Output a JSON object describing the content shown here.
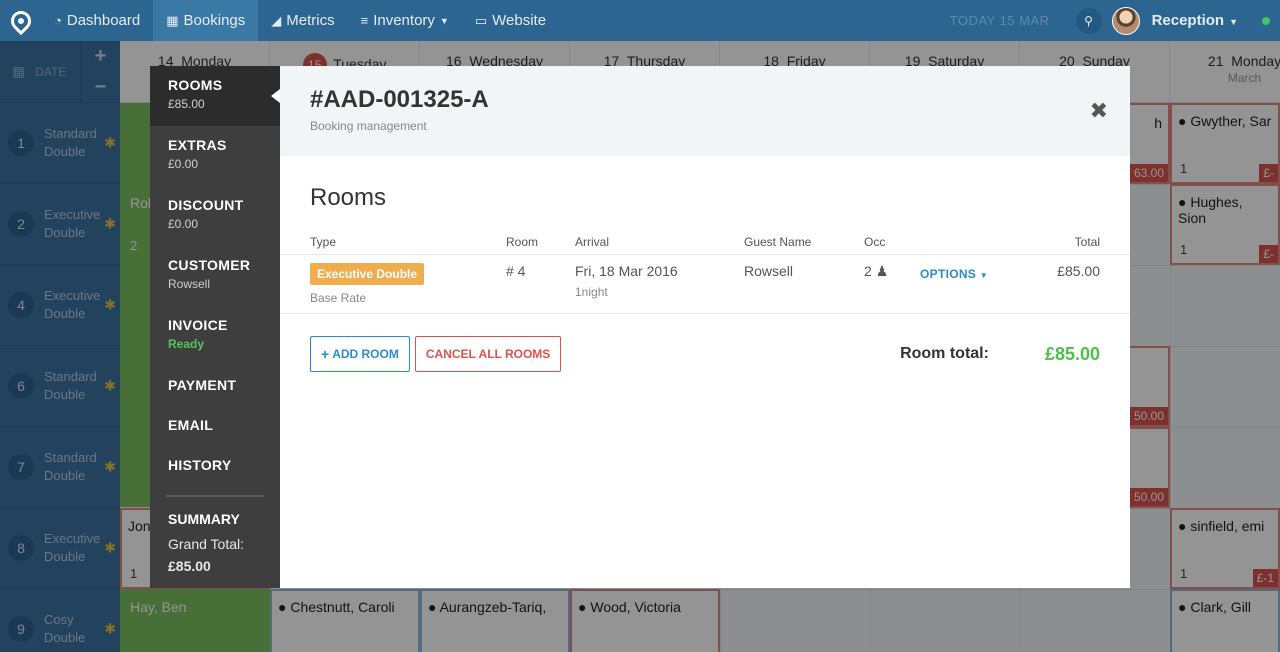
{
  "nav": {
    "items": [
      {
        "icon": "dashboard-icon",
        "glyph": "◔",
        "label": "Dashboard"
      },
      {
        "icon": "bookings-icon",
        "glyph": "▦",
        "label": "Bookings"
      },
      {
        "icon": "metrics-icon",
        "glyph": "◢",
        "label": "Metrics"
      },
      {
        "icon": "inventory-icon",
        "glyph": "≡",
        "label": "Inventory"
      },
      {
        "icon": "website-icon",
        "glyph": "▭",
        "label": "Website"
      }
    ],
    "today": "TODAY 15 MAR",
    "user": "Reception"
  },
  "calendar": {
    "date_label": "DATE",
    "days": [
      {
        "num": "14",
        "name": "Monday"
      },
      {
        "num": "15",
        "name": "Tuesday"
      },
      {
        "num": "16",
        "name": "Wednesday"
      },
      {
        "num": "17",
        "name": "Thursday"
      },
      {
        "num": "18",
        "name": "Friday"
      },
      {
        "num": "19",
        "name": "Saturday"
      },
      {
        "num": "20",
        "name": "Sunday"
      },
      {
        "num": "21",
        "name": "Monday",
        "month": "March"
      }
    ],
    "rooms": [
      {
        "num": "1",
        "line1": "Standard",
        "line2": "Double"
      },
      {
        "num": "2",
        "line1": "Executive",
        "line2": "Double"
      },
      {
        "num": "4",
        "line1": "Executive",
        "line2": "Double"
      },
      {
        "num": "6",
        "line1": "Standard",
        "line2": "Double"
      },
      {
        "num": "7",
        "line1": "Standard",
        "line2": "Double"
      },
      {
        "num": "8",
        "line1": "Executive",
        "line2": "Double"
      },
      {
        "num": "9",
        "line1": "Cosy",
        "line2": "Double"
      }
    ],
    "bookings": {
      "gwyther": "Gwyther, Sar",
      "hughes": "Hughes, Sion",
      "sinfield": "sinfield, emi",
      "clark": "Clark, Gill",
      "chestnutt": "Chestnutt, Caroli",
      "aurangzeb": "Aurangzeb-Tariq,",
      "wood": "Wood, Victoria",
      "hay": "Hay, Ben",
      "jon": "Jon",
      "rol": "Rol",
      "occ_one": "1",
      "occ_two": "2",
      "price_63": "63.00",
      "price_50a": "50.00",
      "price_50b": "50.00",
      "price_neg1": "£-",
      "price_neg2": "£-",
      "price_neg3": "£-1",
      "fragment_h": "h"
    }
  },
  "modal": {
    "sidebar": {
      "rooms_label": "ROOMS",
      "rooms_sub": "£85.00",
      "extras_label": "EXTRAS",
      "extras_sub": "£0.00",
      "discount_label": "DISCOUNT",
      "discount_sub": "£0.00",
      "customer_label": "CUSTOMER",
      "customer_sub": "Rowsell",
      "invoice_label": "INVOICE",
      "invoice_sub": "Ready",
      "payment_label": "PAYMENT",
      "email_label": "EMAIL",
      "history_label": "HISTORY",
      "summary_label": "SUMMARY",
      "grand_total_label": "Grand Total:",
      "grand_total_value": "£85.00"
    },
    "title": "#AAD-001325-A",
    "subtitle": "Booking management",
    "section_title": "Rooms",
    "columns": {
      "type": "Type",
      "room": "Room",
      "arrival": "Arrival",
      "guest": "Guest Name",
      "occ": "Occ",
      "total": "Total"
    },
    "row": {
      "type": "Executive Double",
      "rate": "Base Rate",
      "room": "# 4",
      "arrival": "Fri, 18 Mar 2016",
      "nights": "1night",
      "guest": "Rowsell",
      "occ": "2",
      "options": "OPTIONS",
      "total": "£85.00"
    },
    "add_room": "ADD ROOM",
    "cancel_all": "CANCEL ALL ROOMS",
    "room_total_label": "Room total:",
    "room_total_value": "£85.00"
  },
  "colors": {
    "accent": "#2c6590",
    "success": "#4cc04c",
    "danger": "#d9534f",
    "warning": "#f0ad4e"
  }
}
